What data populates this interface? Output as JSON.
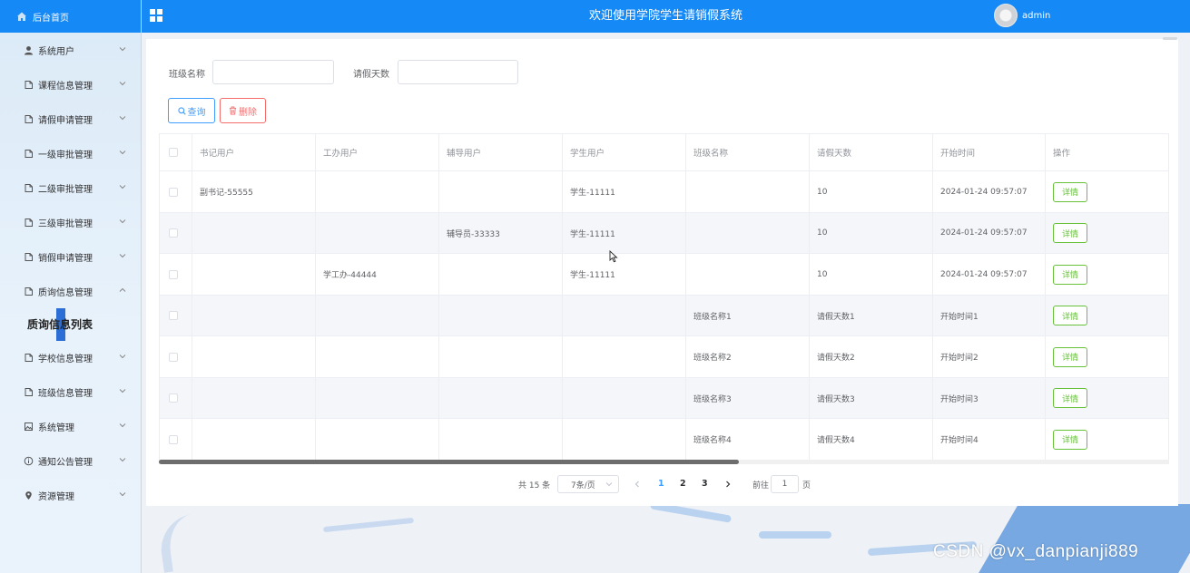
{
  "sidebar": {
    "home": "后台首页",
    "items": [
      {
        "label": "系统用户",
        "icon": "user-icon"
      },
      {
        "label": "课程信息管理",
        "icon": "doc-icon"
      },
      {
        "label": "请假申请管理",
        "icon": "doc-icon"
      },
      {
        "label": "一级审批管理",
        "icon": "doc-icon"
      },
      {
        "label": "二级审批管理",
        "icon": "doc-icon"
      },
      {
        "label": "三级审批管理",
        "icon": "doc-icon"
      },
      {
        "label": "销假申请管理",
        "icon": "doc-icon"
      },
      {
        "label": "质询信息管理",
        "icon": "doc-icon",
        "expanded": true
      }
    ],
    "sub_item": "质询信息列表",
    "items2": [
      {
        "label": "学校信息管理",
        "icon": "doc-icon"
      },
      {
        "label": "班级信息管理",
        "icon": "doc-icon"
      },
      {
        "label": "系统管理",
        "icon": "image-icon"
      },
      {
        "label": "通知公告管理",
        "icon": "info-icon"
      },
      {
        "label": "资源管理",
        "icon": "location-icon"
      }
    ]
  },
  "header": {
    "title": "欢迎使用学院学生请销假系统",
    "user": "admin"
  },
  "search": {
    "class_label": "班级名称",
    "days_label": "请假天数",
    "query_btn": "查询",
    "delete_btn": "删除"
  },
  "table": {
    "columns": [
      "书记用户",
      "工办用户",
      "辅导用户",
      "学生用户",
      "班级名称",
      "请假天数",
      "开始时间",
      "操作"
    ],
    "rows": [
      [
        "副书记-55555",
        "",
        "",
        "学生-11111",
        "",
        "10",
        "2024-01-24 09:57:07"
      ],
      [
        "",
        "",
        "辅导员-33333",
        "学生-11111",
        "",
        "10",
        "2024-01-24 09:57:07"
      ],
      [
        "",
        "学工办-44444",
        "",
        "学生-11111",
        "",
        "10",
        "2024-01-24 09:57:07"
      ],
      [
        "",
        "",
        "",
        "",
        "班级名称1",
        "请假天数1",
        "开始时间1"
      ],
      [
        "",
        "",
        "",
        "",
        "班级名称2",
        "请假天数2",
        "开始时间2"
      ],
      [
        "",
        "",
        "",
        "",
        "班级名称3",
        "请假天数3",
        "开始时间3"
      ],
      [
        "",
        "",
        "",
        "",
        "班级名称4",
        "请假天数4",
        "开始时间4"
      ]
    ],
    "detail_btn": "详情"
  },
  "pagination": {
    "total": "共 15 条",
    "page_size": "7条/页",
    "pages": [
      "1",
      "2",
      "3"
    ],
    "current": "1",
    "goto_label": "前往",
    "goto_value": "1",
    "page_suffix": "页"
  },
  "watermark": "CSDN @vx_danpianji889",
  "colors": {
    "primary": "#1589f5",
    "danger": "#f56c6c",
    "success": "#67c23a",
    "link": "#409eff"
  }
}
